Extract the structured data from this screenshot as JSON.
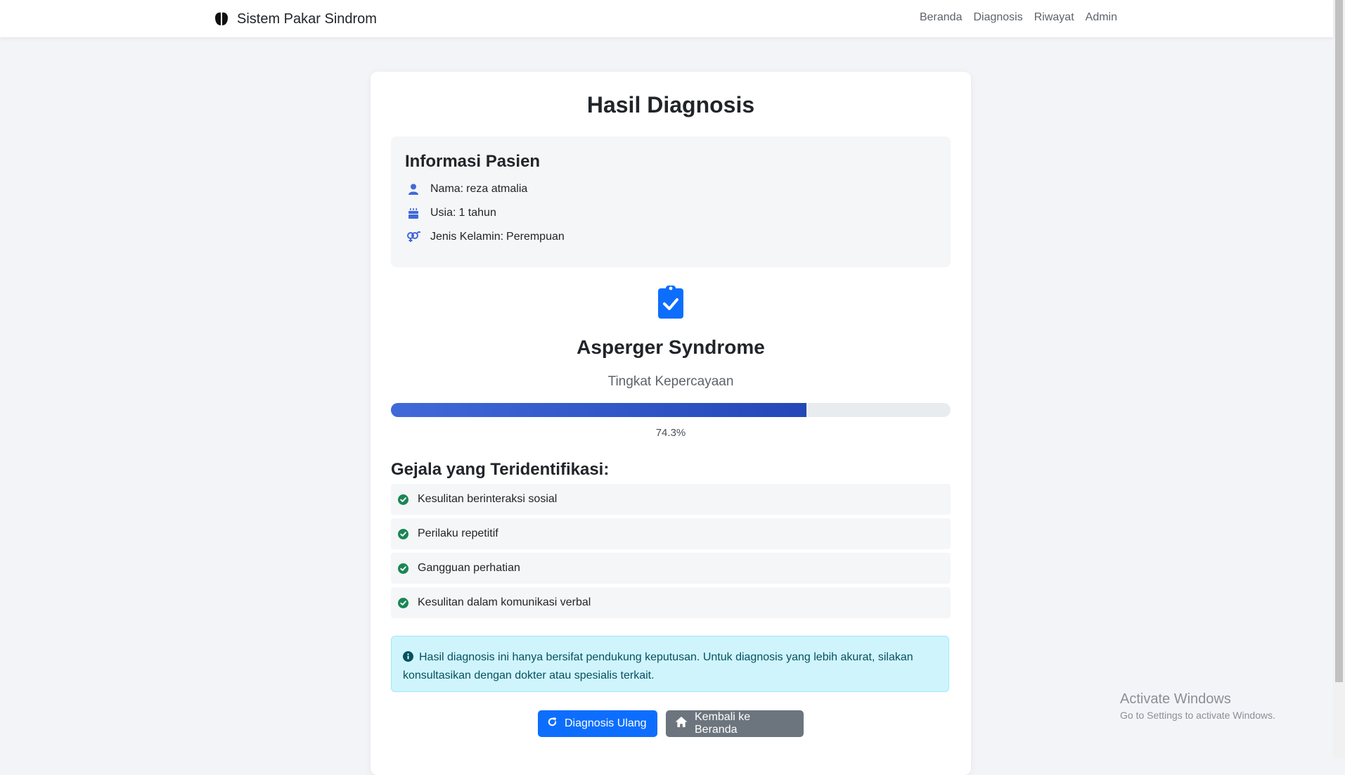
{
  "navbar": {
    "brand": "Sistem Pakar Sindrom",
    "links": [
      "Beranda",
      "Diagnosis",
      "Riwayat",
      "Admin"
    ]
  },
  "page": {
    "title": "Hasil Diagnosis"
  },
  "patient": {
    "title": "Informasi Pasien",
    "name_label": "Nama:",
    "name": "reza atmalia",
    "age_label": "Usia:",
    "age": "1 tahun",
    "gender_label": "Jenis Kelamin:",
    "gender": "Perempuan"
  },
  "result": {
    "diagnosis": "Asperger Syndrome",
    "confidence_label": "Tingkat Kepercayaan",
    "confidence_value": "74.3%",
    "confidence_fraction": 0.743
  },
  "symptoms": {
    "title": "Gejala yang Teridentifikasi:",
    "items": [
      "Kesulitan berinteraksi sosial",
      "Perilaku repetitif",
      "Gangguan perhatian",
      "Kesulitan dalam komunikasi verbal"
    ]
  },
  "alert": {
    "text": "Hasil diagnosis ini hanya bersifat pendukung keputusan. Untuk diagnosis yang lebih akurat, silakan konsultasikan dengan dokter atau spesialis terkait."
  },
  "buttons": {
    "retry": "Diagnosis Ulang",
    "home": "Kembali ke Beranda"
  },
  "watermark": {
    "title": "Activate Windows",
    "subtitle": "Go to Settings to activate Windows."
  },
  "icons": {
    "brand": "brain-icon",
    "name": "user-icon",
    "age": "birthday-cake-icon",
    "gender": "venus-mars-icon",
    "result": "clipboard-check-icon",
    "symptom": "check-circle-icon",
    "alert": "info-circle-icon",
    "retry": "redo-icon",
    "home": "home-icon"
  },
  "colors": {
    "accent": "#0d6efd",
    "icon_blue": "#4169d8",
    "success": "#198754",
    "alert_bg": "#cff4fc",
    "secondary": "#6c757d"
  }
}
